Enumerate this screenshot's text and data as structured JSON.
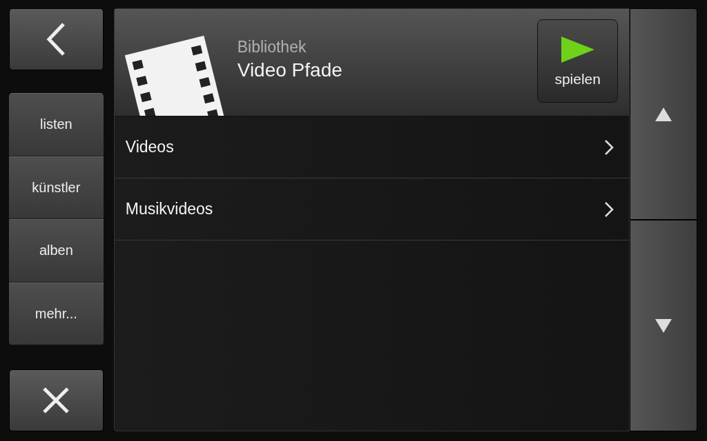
{
  "nav": {
    "items": [
      {
        "label": "listen"
      },
      {
        "label": "künstler"
      },
      {
        "label": "alben"
      },
      {
        "label": "mehr..."
      }
    ]
  },
  "header": {
    "subtitle": "Bibliothek",
    "title": "Video Pfade",
    "play_button": {
      "label": "spielen"
    }
  },
  "list": {
    "rows": [
      {
        "label": "Videos"
      },
      {
        "label": "Musikvideos"
      }
    ]
  }
}
